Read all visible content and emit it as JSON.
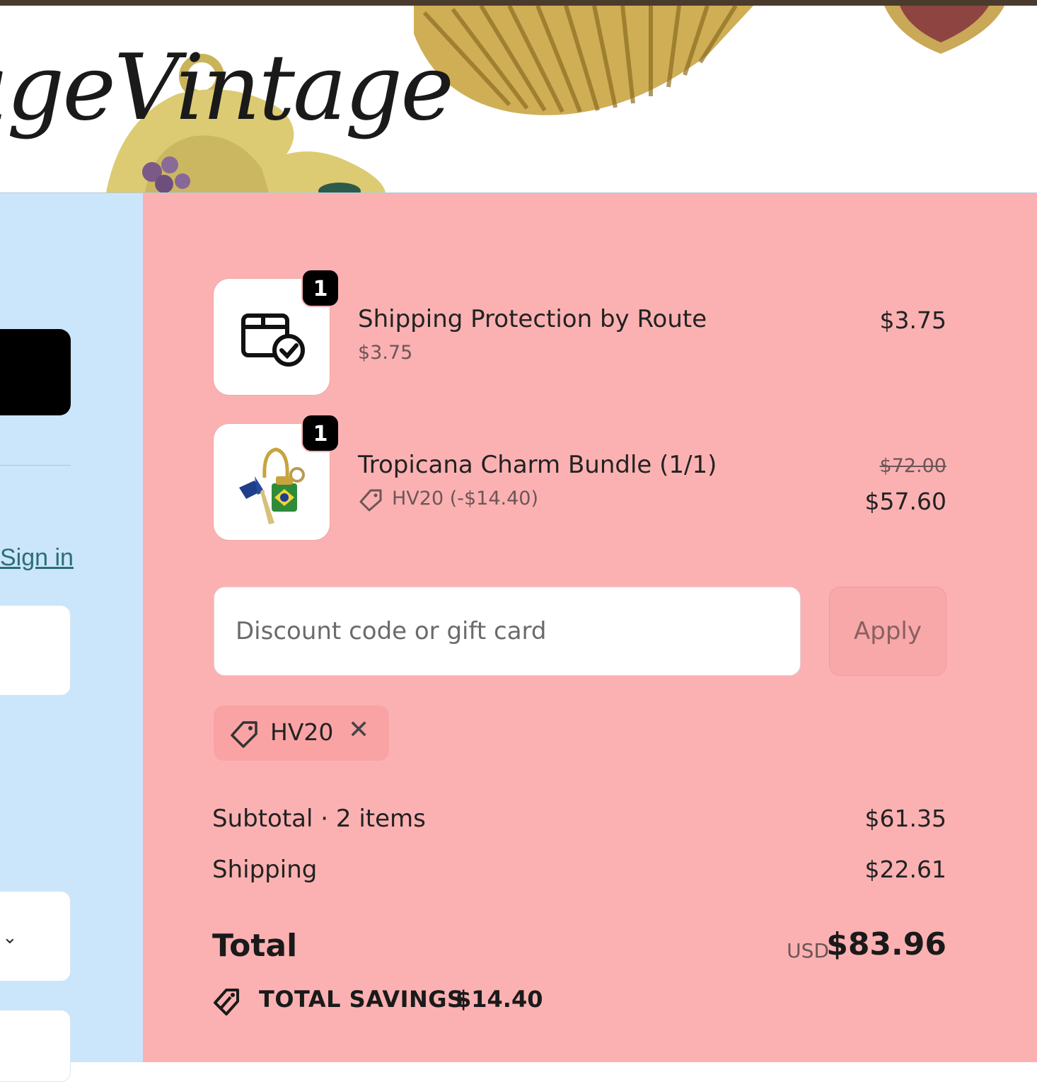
{
  "header": {
    "brand_text": "ageVintage"
  },
  "left_panel": {
    "sign_in_link": "Sign in",
    "select_icon": "chevron-down-icon"
  },
  "order_summary": {
    "items": [
      {
        "name": "Shipping Protection by Route",
        "quantity": "1",
        "unit_price": "$3.75",
        "price": "$3.75",
        "thumbnail_icon": "package-check-icon"
      },
      {
        "name": "Tropicana Charm Bundle (1/1)",
        "quantity": "1",
        "discount_note": "HV20 (-$14.40)",
        "original_price": "$72.00",
        "price": "$57.60",
        "thumbnail_icon": "charm-bundle-photo"
      }
    ],
    "discount": {
      "placeholder": "Discount code or gift card",
      "value": "",
      "apply_label": "Apply",
      "applied_code": "HV20"
    },
    "subtotal_label": "Subtotal · 2 items",
    "subtotal_value": "$61.35",
    "shipping_label": "Shipping",
    "shipping_value": "$22.61",
    "total_label": "Total",
    "total_currency": "USD",
    "total_value": "$83.96",
    "savings_label": "TOTAL SAVINGS",
    "savings_value": "$14.40"
  },
  "colors": {
    "left_panel_bg": "#cbe5fb",
    "summary_bg": "#fbb1b2",
    "link": "#2a6f73",
    "badge": "#000000"
  }
}
